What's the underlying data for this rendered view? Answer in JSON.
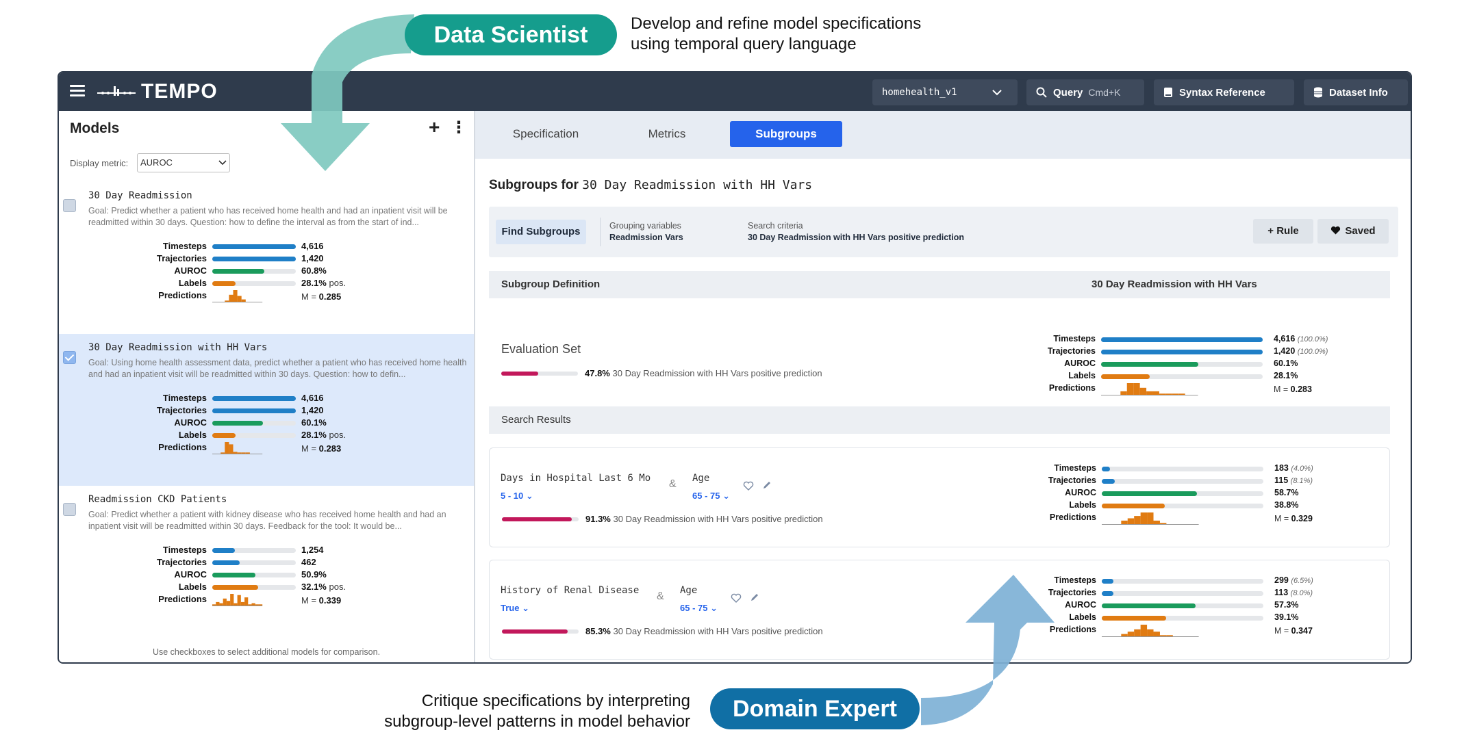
{
  "annotations": {
    "data_scientist": "Data Scientist",
    "data_scientist_desc_1": "Develop and refine model specifications",
    "data_scientist_desc_2": "using temporal query language",
    "domain_expert": "Domain Expert",
    "domain_expert_desc_1": "Critique specifications by interpreting",
    "domain_expert_desc_2": "subgroup-level patterns in model behavior"
  },
  "topbar": {
    "app_name": "TEMPO",
    "dataset": "homehealth_v1",
    "query_label": "Query",
    "query_shortcut": "Cmd+K",
    "syntax_label": "Syntax Reference",
    "dataset_info_label": "Dataset Info"
  },
  "left": {
    "title": "Models",
    "add": "+",
    "more": "⋮",
    "display_metric_label": "Display metric:",
    "display_metric_value": "AUROC",
    "footer": "Use checkboxes to select additional models for comparison.",
    "metric_labels": [
      "Timesteps",
      "Trajectories",
      "AUROC",
      "Labels",
      "Predictions"
    ],
    "models": [
      {
        "name": "30 Day Readmission",
        "goal": "Goal: Predict whether a patient who has received home health and had an inpatient visit will be readmitted within 30 days. Question: how to define the interval as from the start of ind...",
        "selected": false,
        "timesteps": "4,616",
        "timesteps_frac": 1.0,
        "trajectories": "1,420",
        "trajectories_frac": 1.0,
        "auroc": "60.8%",
        "auroc_frac": 0.62,
        "labels": "28.1%",
        "labels_suffix": " pos.",
        "labels_frac": 0.281,
        "mean": "0.285",
        "mean_prefix": "M = ",
        "hist": [
          0,
          0,
          0,
          0.1,
          0.6,
          1.0,
          0.5,
          0.2,
          0,
          0,
          0,
          0
        ]
      },
      {
        "name": "30 Day Readmission with HH Vars",
        "goal": "Goal: Using home health assessment data, predict whether a patient who has received home health and had an inpatient visit will be readmitted within 30 days. Question: how to defin...",
        "selected": true,
        "timesteps": "4,616",
        "timesteps_frac": 1.0,
        "trajectories": "1,420",
        "trajectories_frac": 1.0,
        "auroc": "60.1%",
        "auroc_frac": 0.61,
        "labels": "28.1%",
        "labels_suffix": " pos.",
        "labels_frac": 0.281,
        "mean": "0.283",
        "mean_prefix": "M = ",
        "hist": [
          0,
          0,
          0.1,
          1.0,
          0.8,
          0.15,
          0.1,
          0.1,
          0.1,
          0,
          0,
          0
        ]
      },
      {
        "name": "Readmission CKD Patients",
        "goal": "Goal: Predict whether a patient with kidney disease who has received home health and had an inpatient visit will be readmitted within 30 days. Feedback for the tool: It would be...",
        "selected": false,
        "timesteps": "1,254",
        "timesteps_frac": 0.27,
        "trajectories": "462",
        "trajectories_frac": 0.33,
        "auroc": "50.9%",
        "auroc_frac": 0.52,
        "labels": "32.1%",
        "labels_suffix": " pos.",
        "labels_frac": 0.55,
        "mean": "0.339",
        "mean_prefix": "M = ",
        "hist": [
          0.1,
          0.3,
          0.2,
          0.6,
          0.4,
          1.0,
          0.2,
          0.9,
          0.3,
          0.7,
          0.1,
          0.2,
          0.1,
          0.1
        ]
      }
    ]
  },
  "right": {
    "tabs": [
      "Specification",
      "Metrics",
      "Subgroups"
    ],
    "title_prefix": "Subgroups for",
    "title_model": "30 Day Readmission with HH Vars",
    "find_button": "Find Subgroups",
    "grouping_caption": "Grouping variables",
    "grouping_value": "Readmission Vars",
    "search_caption": "Search criteria",
    "search_value": "30 Day Readmission with HH Vars positive prediction",
    "rule_button": "Rule",
    "saved_button": "Saved",
    "definition_header": "Subgroup Definition",
    "definition_header_right": "30 Day Readmission with HH Vars",
    "search_results_header": "Search Results",
    "pred_suffix": "30 Day Readmission with HH Vars positive prediction",
    "eval_set": {
      "label": "Evaluation Set",
      "pred_pct": "47.8%",
      "pred_frac": 0.478,
      "timesteps": "4,616",
      "timesteps_paren": "(100.0%)",
      "timesteps_frac": 1.0,
      "trajectories": "1,420",
      "trajectories_paren": "(100.0%)",
      "trajectories_frac": 1.0,
      "auroc": "60.1%",
      "auroc_frac": 0.6,
      "labels": "28.1%",
      "labels_frac": 0.3,
      "mean": "0.283",
      "mean_prefix": "M = ",
      "hist": [
        0,
        0,
        0,
        0.3,
        1.0,
        1.0,
        0.6,
        0.3,
        0.3,
        0.1,
        0.1,
        0.1,
        0.1,
        0,
        0
      ]
    },
    "results": [
      {
        "cond1_name": "Days in Hospital Last 6 Mo",
        "cond1_value": "5 - 10",
        "cond2_name": "Age",
        "cond2_value": "65 - 75",
        "pred_pct": "91.3%",
        "pred_frac": 0.913,
        "timesteps": "183",
        "timesteps_paren": "(4.0%)",
        "timesteps_frac": 0.05,
        "trajectories": "115",
        "trajectories_paren": "(8.1%)",
        "trajectories_frac": 0.08,
        "auroc": "58.7%",
        "auroc_frac": 0.59,
        "labels": "38.8%",
        "labels_frac": 0.39,
        "mean": "0.329",
        "mean_prefix": "M = ",
        "hist": [
          0,
          0,
          0,
          0.3,
          0.5,
          0.7,
          1.0,
          1.0,
          0.3,
          0.1,
          0,
          0,
          0,
          0,
          0
        ]
      },
      {
        "cond1_name": "History of Renal Disease",
        "cond1_value": "True",
        "cond2_name": "Age",
        "cond2_value": "65 - 75",
        "pred_pct": "85.3%",
        "pred_frac": 0.853,
        "timesteps": "299",
        "timesteps_paren": "(6.5%)",
        "timesteps_frac": 0.07,
        "trajectories": "113",
        "trajectories_paren": "(8.0%)",
        "trajectories_frac": 0.07,
        "auroc": "57.3%",
        "auroc_frac": 0.58,
        "labels": "39.1%",
        "labels_frac": 0.4,
        "mean": "0.347",
        "mean_prefix": "M = ",
        "hist": [
          0,
          0,
          0,
          0.2,
          0.4,
          0.6,
          1.0,
          0.6,
          0.4,
          0.1,
          0.1,
          0,
          0,
          0,
          0
        ]
      }
    ]
  },
  "colors": {
    "timesteps": "#1f7fc7",
    "trajectories": "#1f7fc7",
    "auroc": "#1a9b5c",
    "labels": "#e07b12",
    "predictions": "#e07b12",
    "positive_prediction": "#c2185b",
    "accent": "#2563eb",
    "arrow_top": "#7fc9bf",
    "arrow_bottom": "#7eb1d6"
  }
}
